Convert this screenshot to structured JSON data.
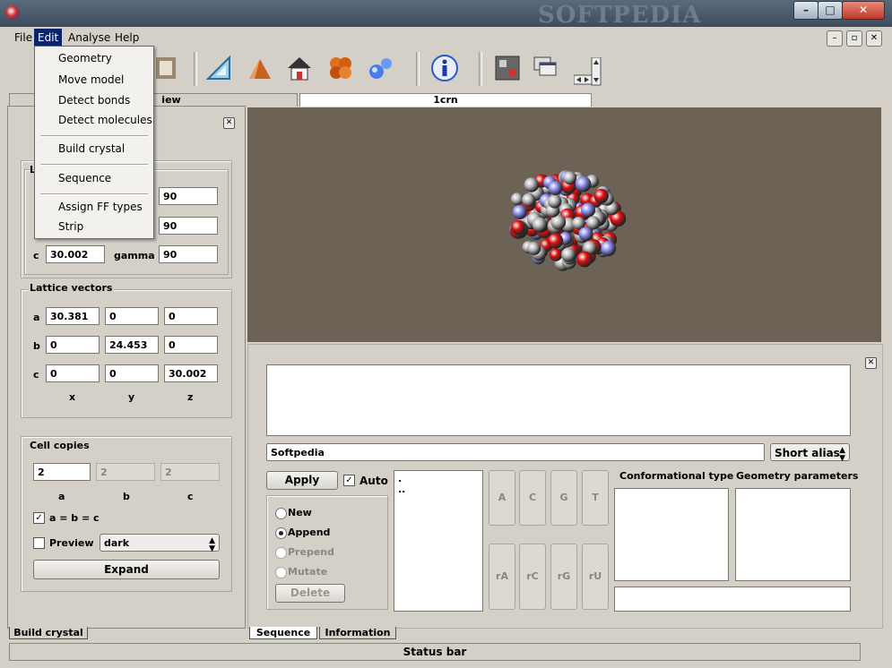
{
  "window": {
    "watermark": "SOFTPEDIA",
    "controls": {
      "minimize": "–",
      "maximize": "□",
      "close": "✕"
    }
  },
  "menubar": {
    "file": "File",
    "edit": "Edit",
    "analyse": "Analyse",
    "help": "Help"
  },
  "edit_menu": {
    "items": [
      "Geometry",
      "Move model",
      "Detect bonds",
      "Detect molecules",
      "Build crystal",
      "Sequence",
      "Assign FF types",
      "Strip"
    ]
  },
  "tabs": {
    "tab1_visible": "iew",
    "tab2": "1crn"
  },
  "left_panel": {
    "angles": {
      "alpha": "90",
      "beta": "90",
      "c_label": "c",
      "c_value": "30.002",
      "gamma_label": "gamma",
      "gamma_value": "90"
    },
    "lattice_vectors": {
      "title": "Lattice vectors",
      "row_labels": [
        "a",
        "b",
        "c"
      ],
      "values": [
        [
          "30.381",
          "0",
          "0"
        ],
        [
          "0",
          "24.453",
          "0"
        ],
        [
          "0",
          "0",
          "30.002"
        ]
      ],
      "col_labels": [
        "x",
        "y",
        "z"
      ]
    },
    "cell_copies": {
      "title": "Cell copies",
      "values": [
        "2",
        "2",
        "2"
      ],
      "labels": [
        "a",
        "b",
        "c"
      ],
      "equal_label": "a = b = c",
      "equal_checked": true,
      "preview_label": "Preview",
      "preview_checked": false,
      "style": "dark",
      "expand": "Expand"
    }
  },
  "lower_panel": {
    "name_value": "Softpedia",
    "alias_select": "Short alias",
    "apply": "Apply",
    "auto_label": "Auto",
    "auto_checked": true,
    "modes": [
      "New",
      "Append",
      "Prepend",
      "Mutate"
    ],
    "mode_selected": "Append",
    "delete": "Delete",
    "list_items": [
      ".",
      ".."
    ],
    "residue_buttons_row1": [
      "A",
      "C",
      "G",
      "T"
    ],
    "residue_buttons_row2": [
      "rA",
      "rC",
      "rG",
      "rU"
    ],
    "conformational_type": "Conformational type",
    "geometry_parameters": "Geometry parameters"
  },
  "bottom_tabs": {
    "left": "Build crystal",
    "seq": "Sequence",
    "info": "Information"
  },
  "status_bar": "Status bar",
  "colors": {
    "viewer_bg": "#6c6256",
    "menu_highlight": "#0a246a",
    "oxygen": "#e01010",
    "carbon": "#b8b8b8",
    "nitrogen": "#8c8cf0"
  }
}
